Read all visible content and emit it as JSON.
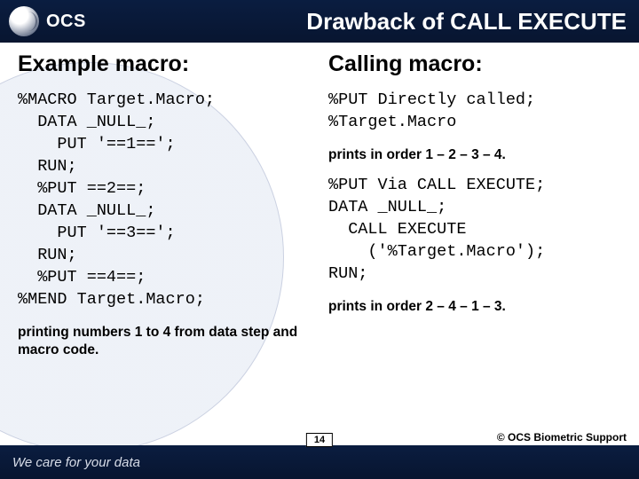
{
  "header": {
    "brand": "OCS",
    "title": "Drawback of CALL EXECUTE"
  },
  "left": {
    "heading": "Example macro:",
    "code": "%MACRO Target.Macro;\n  DATA _NULL_;\n    PUT '==1==';\n  RUN;\n  %PUT ==2==;\n  DATA _NULL_;\n    PUT '==3==';\n  RUN;\n  %PUT ==4==;\n%MEND Target.Macro;",
    "note": "printing numbers 1 to 4 from data step and macro code."
  },
  "right": {
    "heading": "Calling macro:",
    "code1": "%PUT Directly called;\n%Target.Macro",
    "note1": "prints in order 1 – 2 – 3 – 4.",
    "code2": "%PUT Via CALL EXECUTE;\nDATA _NULL_;\n  CALL EXECUTE\n    ('%Target.Macro');\nRUN;",
    "note2": "prints in order 2 – 4 – 1 – 3."
  },
  "footer": {
    "tagline": "We care for your data",
    "page": "14",
    "copyright": "© OCS Biometric Support"
  }
}
